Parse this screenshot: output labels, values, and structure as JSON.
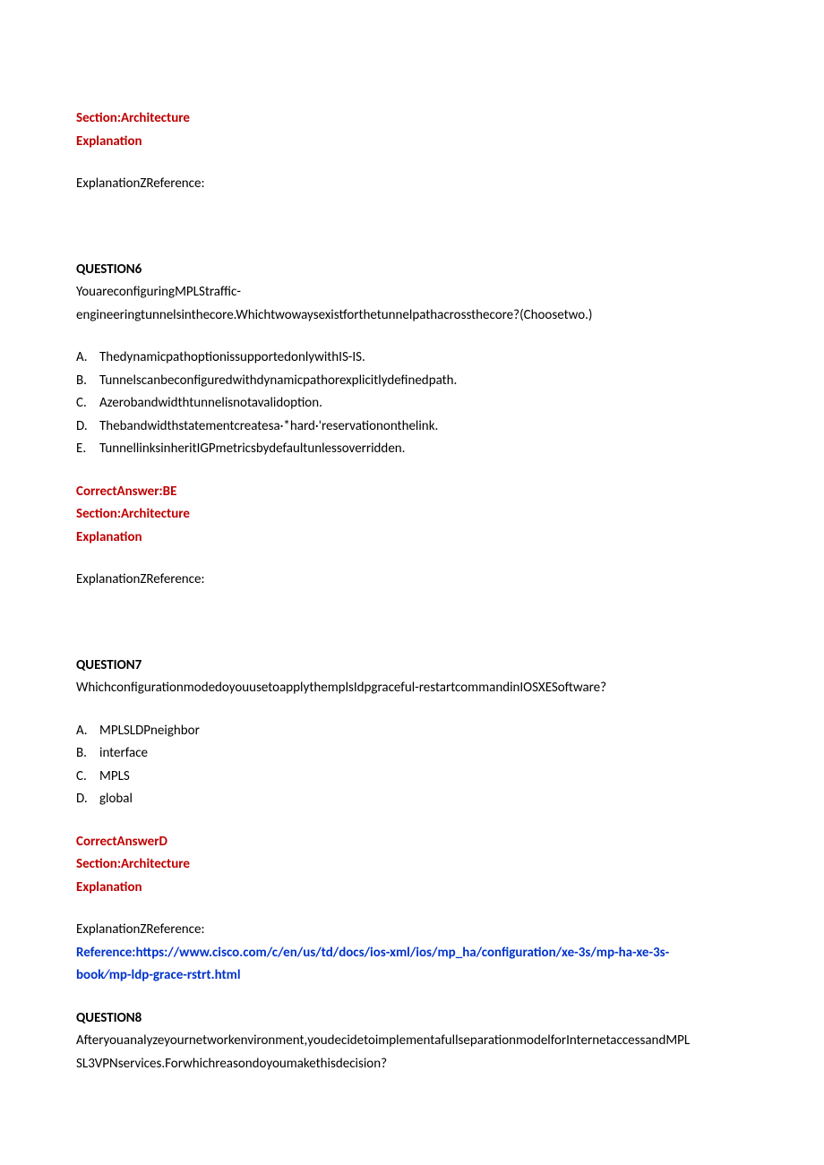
{
  "intro": {
    "section": "Section:Architecture",
    "explanation_label": "Explanation",
    "explanation_ref": "ExplanationZReference:"
  },
  "q6": {
    "heading": "QUESTION6",
    "prompt_line1": "YouareconfiguringMPLStraffic-",
    "prompt_line2": "engineeringtunnelsinthecore.Whichtwowaysexistforthetunnelpathacrossthecore?(Choosetwo.)",
    "options": [
      {
        "letter": "A.",
        "text": "ThedynamicpathoptionissupportedonlywithIS-IS."
      },
      {
        "letter": "B.",
        "text": "Tunnelscanbeconfiguredwithdynamicpathorexplicitlydefinedpath."
      },
      {
        "letter": "C.",
        "text": "Azerobandwidthtunnelisnotavalidoption."
      },
      {
        "letter": "D.",
        "text": "Thebandwidthstatementcreatesa·*hard·'reservationonthelink."
      },
      {
        "letter": "E.",
        "text": "TunnellinksinheritIGPmetricsbydefaultunlessoverridden."
      }
    ],
    "answer": "CorrectAnswer:BE",
    "section": "Section:Architecture",
    "explanation_label": "Explanation",
    "explanation_ref": "ExplanationZReference:"
  },
  "q7": {
    "heading": "QUESTION7",
    "prompt": "WhichconfigurationmodedoyouusetoapplythemplsIdpgraceful-restartcommandinIOSXESoftware?",
    "options": [
      {
        "letter": "A.",
        "text": "MPLSLDPneighbor"
      },
      {
        "letter": "B.",
        "text": "interface"
      },
      {
        "letter": "C.",
        "text": "MPLS"
      },
      {
        "letter": "D.",
        "text": "global"
      }
    ],
    "answer": "CorrectAnswerD",
    "section": "Section:Architecture",
    "explanation_label": "Explanation",
    "explanation_ref": "ExplanationZReference:",
    "reference_label": "Reference:",
    "reference_url1": "https://www.cisco.com/c/en/us/td/docs/ios-xml/ios/mp_ha/configuration/xe-3s/mp-ha-xe-3s-",
    "reference_url2": "book⁄mp-ldp-grace-rstrt.html"
  },
  "q8": {
    "heading": "QUESTION8",
    "prompt_line1": "Afteryouanalyzeyournetworkenvironment,youdecidetoimplementafullseparationmodelforInternetaccessandMPL",
    "prompt_line2": "SL3VPNservices.Forwhichreasondoyoumakethisdecision?"
  }
}
